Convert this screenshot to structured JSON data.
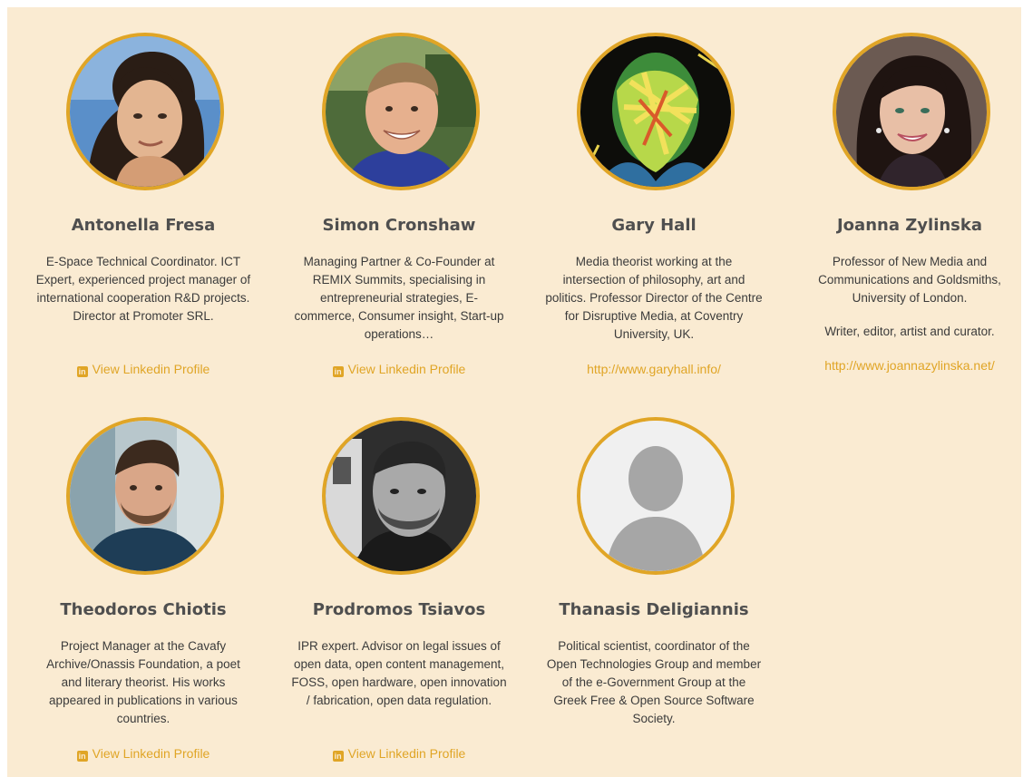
{
  "team": {
    "members": [
      {
        "name": "Antonella Fresa",
        "bio": [
          "E-Space Technical Coordinator. ICT Expert, experienced project manager of international cooperation R&D projects. Director at Promoter SRL."
        ],
        "link_label": "View Linkedin Profile",
        "link_icon": "linkedin-icon"
      },
      {
        "name": "Simon Cronshaw",
        "bio": [
          "Managing Partner & Co-Founder at REMIX Summits, specialising in entrepreneurial strategies, E-commerce, Consumer insight, Start-up operations…"
        ],
        "link_label": "View Linkedin Profile",
        "link_icon": "linkedin-icon"
      },
      {
        "name": "Gary Hall",
        "bio": [
          "Media theorist working at the intersection of philosophy, art and politics. Professor Director of the Centre for Disruptive Media, at Coventry University, UK."
        ],
        "link_label": "http://www.garyhall.info/"
      },
      {
        "name": "Joanna Zylinska",
        "bio": [
          "Professor of New Media and Communications and Goldsmiths, University of London.",
          "Writer, editor, artist and curator."
        ],
        "link_label": "http://www.joannazylinska.net/"
      },
      {
        "name": "Theodoros Chiotis",
        "bio": [
          "Project Manager at the Cavafy Archive/Onassis Foundation, a poet and literary theorist. His works appeared in publications in various countries."
        ],
        "link_label": "View Linkedin Profile",
        "link_icon": "linkedin-icon"
      },
      {
        "name": "Prodromos Tsiavos",
        "bio": [
          "IPR expert. Advisor on legal issues of open data, open content management, FOSS, open hardware, open innovation / fabrication, open data regulation."
        ],
        "link_label": "View Linkedin Profile",
        "link_icon": "linkedin-icon"
      },
      {
        "name": "Thanasis Deligiannis",
        "bio": [
          "Political scientist, coordinator of the Open Technologies Group and member of the e-Government Group at the Greek Free & Open Source Software Society."
        ]
      }
    ]
  },
  "colors": {
    "background": "#faebd2",
    "accent": "#e0a526",
    "name_text": "#4f4f4f",
    "body_text": "#3b3b3b"
  }
}
